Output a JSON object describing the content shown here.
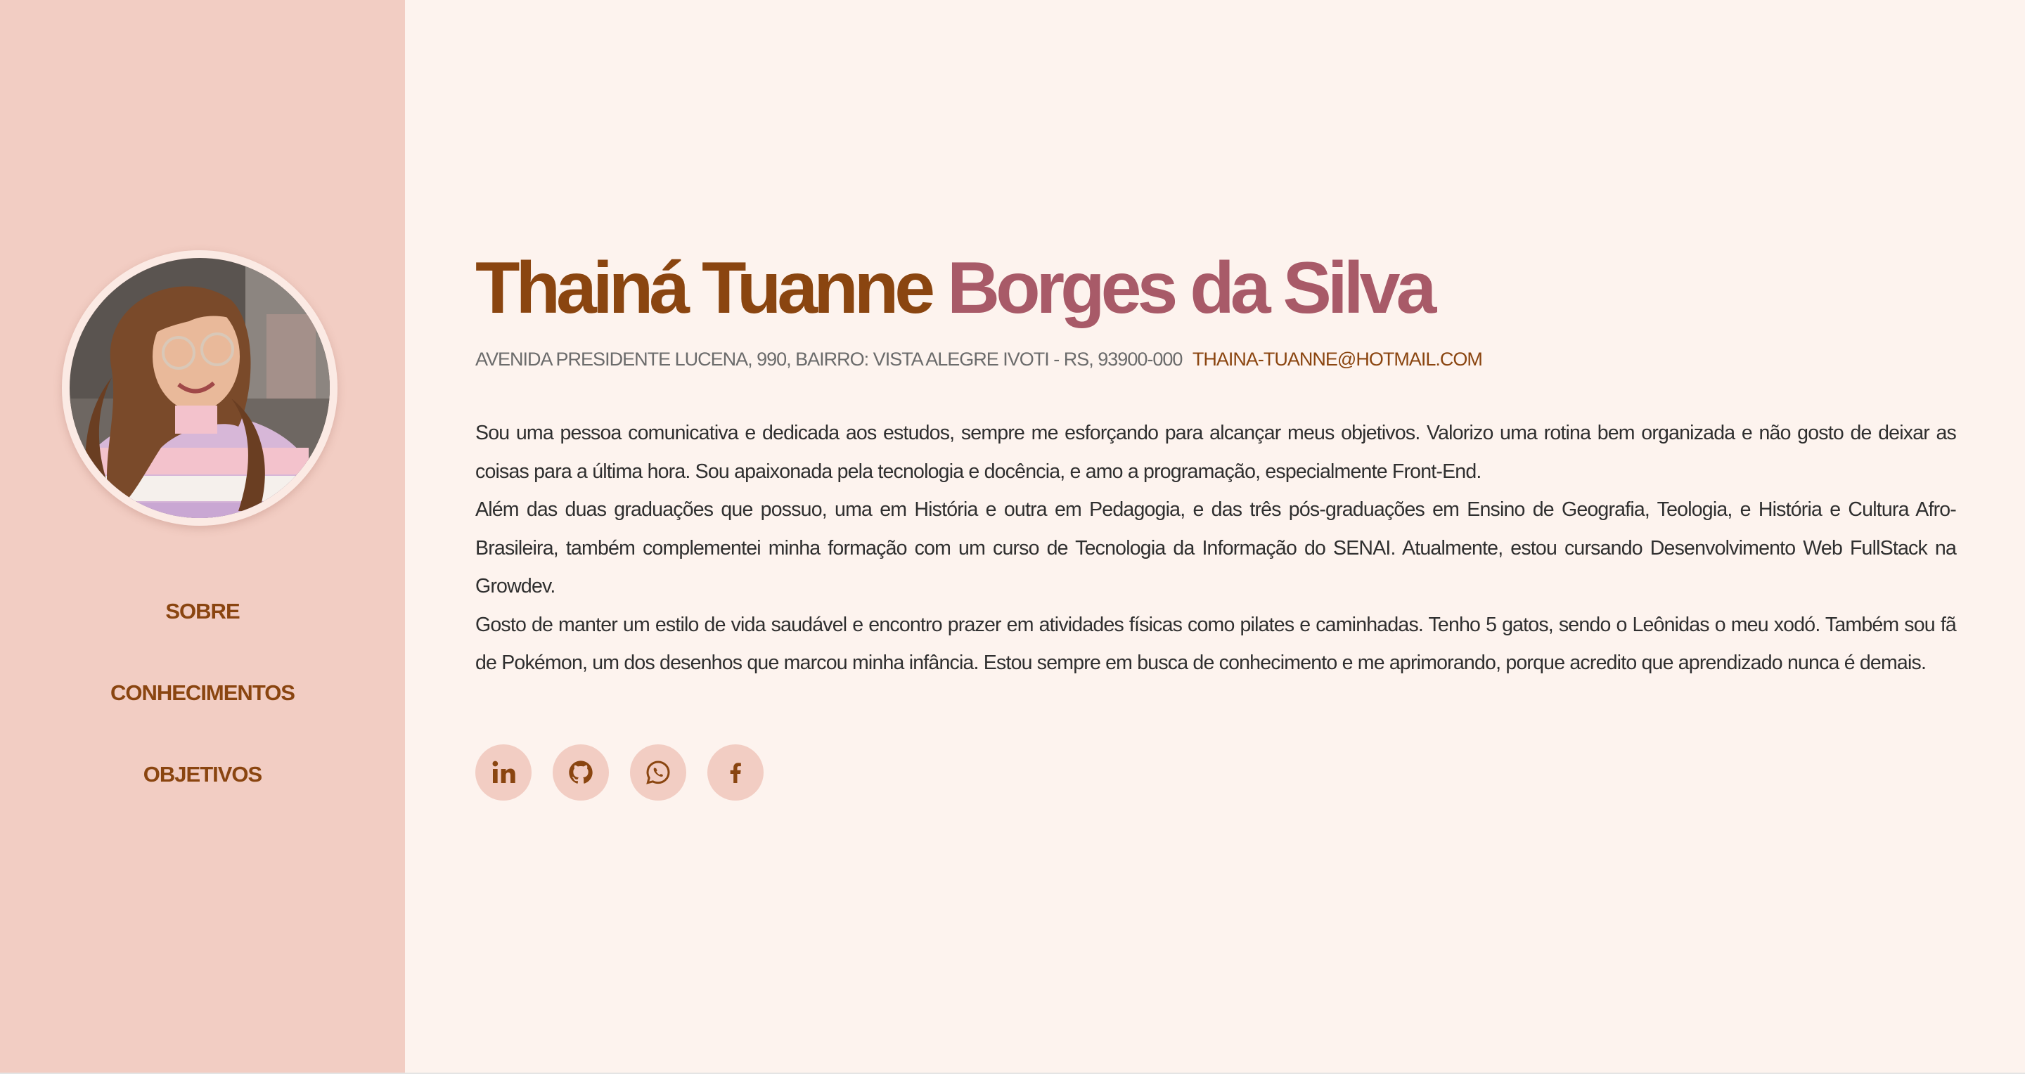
{
  "profile": {
    "first_name": "Thainá Tuanne",
    "last_name": "Borges da Silva",
    "address": "AVENIDA PRESIDENTE LUCENA, 990, BAIRRO: VISTA ALEGRE IVOTI - RS, 93900-000",
    "email": "THAINA-TUANNE@HOTMAIL.COM"
  },
  "nav": {
    "items": [
      {
        "label": "SOBRE"
      },
      {
        "label": "CONHECIMENTOS"
      },
      {
        "label": "OBJETIVOS"
      }
    ]
  },
  "bio": {
    "paragraphs": [
      "Sou uma pessoa comunicativa e dedicada aos estudos, sempre me esforçando para alcançar meus objetivos. Valorizo uma rotina bem organizada e não gosto de deixar as coisas para a última hora. Sou apaixonada pela tecnologia e docência, e amo a programação, especialmente Front-End.",
      "Além das duas graduações que possuo, uma em História e outra em Pedagogia, e das três pós-graduações em Ensino de Geografia, Teologia, e História e Cultura Afro-Brasileira, também complementei minha formação com um curso de Tecnologia da Informação do SENAI. Atualmente, estou cursando Desenvolvimento Web FullStack na Growdev.",
      "Gosto de manter um estilo de vida saudável e encontro prazer em atividades físicas como pilates e caminhadas. Tenho 5 gatos, sendo o Leônidas o meu xodó. Também sou fã de Pokémon, um dos desenhos que marcou minha infância. Estou sempre em busca de conhecimento e me aprimorando, porque acredito que aprendizado nunca é demais."
    ]
  },
  "socials": [
    {
      "icon": "linkedin-icon"
    },
    {
      "icon": "github-icon"
    },
    {
      "icon": "whatsapp-icon"
    },
    {
      "icon": "facebook-icon"
    }
  ],
  "colors": {
    "sidebar_bg": "#f2cdc3",
    "page_bg": "#fdf3ee",
    "brown_accent": "#8a4510",
    "rose_accent": "#a85a68"
  }
}
